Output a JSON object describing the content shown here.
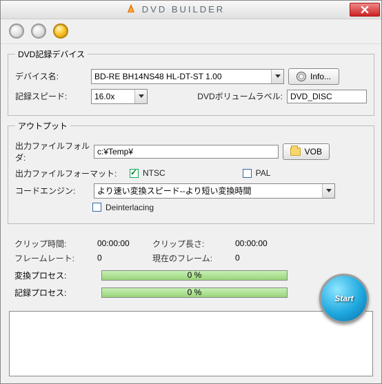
{
  "title": "DVD BUILDER",
  "recording": {
    "legend": "DVD記録デバイス",
    "deviceLabel": "デバイス名:",
    "deviceValue": "BD-RE BH14NS48 HL-DT-ST 1.00",
    "infoBtn": "Info...",
    "speedLabel": "記録スピード:",
    "speedValue": "16.0x",
    "volLabel": "DVDボリュームラベル:",
    "volValue": "DVD_DISC"
  },
  "output": {
    "legend": "アウトプット",
    "folderLabel": "出力ファイルフォルダ:",
    "folderValue": "c:¥Temp¥",
    "vobBtn": "VOB",
    "formatLabel": "出力ファイルフォーマット:",
    "ntsc": "NTSC",
    "pal": "PAL",
    "engineLabel": "コードエンジン:",
    "engineValue": "より速い変換スピード--より短い変換時間",
    "deinterlace": "Deinterlacing"
  },
  "stats": {
    "clipTimeLabel": "クリップ時間:",
    "clipTime": "00:00:00",
    "clipLenLabel": "クリップ長さ:",
    "clipLen": "00:00:00",
    "frameRateLabel": "フレームレート:",
    "frameRate": "0",
    "curFrameLabel": "現在のフレーム:",
    "curFrame": "0"
  },
  "progress": {
    "convLabel": "変換プロセス:",
    "convText": "0 %",
    "recLabel": "記録プロセス:",
    "recText": "0 %"
  },
  "startLabel": "Start"
}
